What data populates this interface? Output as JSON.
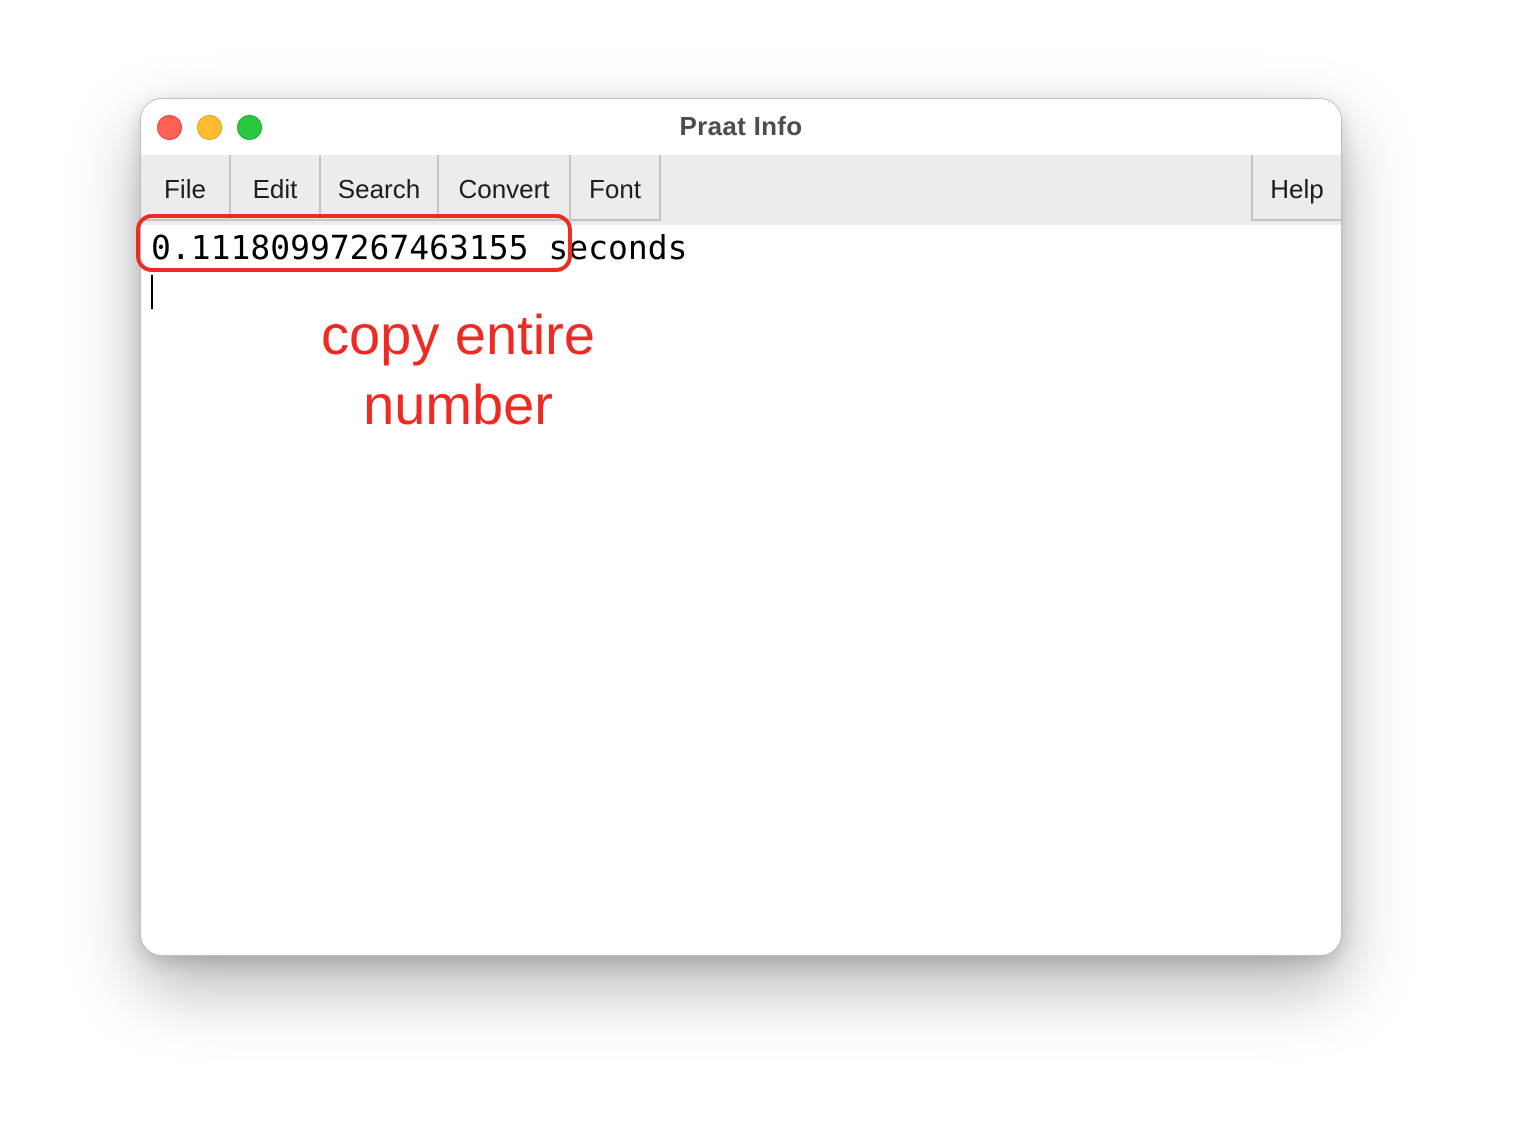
{
  "window": {
    "title": "Praat Info"
  },
  "menubar": {
    "items": [
      "File",
      "Edit",
      "Search",
      "Convert",
      "Font"
    ],
    "help_label": "Help"
  },
  "info": {
    "value": "0.11180997267463155",
    "unit": "seconds"
  },
  "annotation": {
    "line1": "copy entire",
    "line2": "number",
    "color": "#ee2a22"
  },
  "colors": {
    "close": "#fe5f57",
    "minimize": "#febc2e",
    "zoom": "#28c840"
  }
}
